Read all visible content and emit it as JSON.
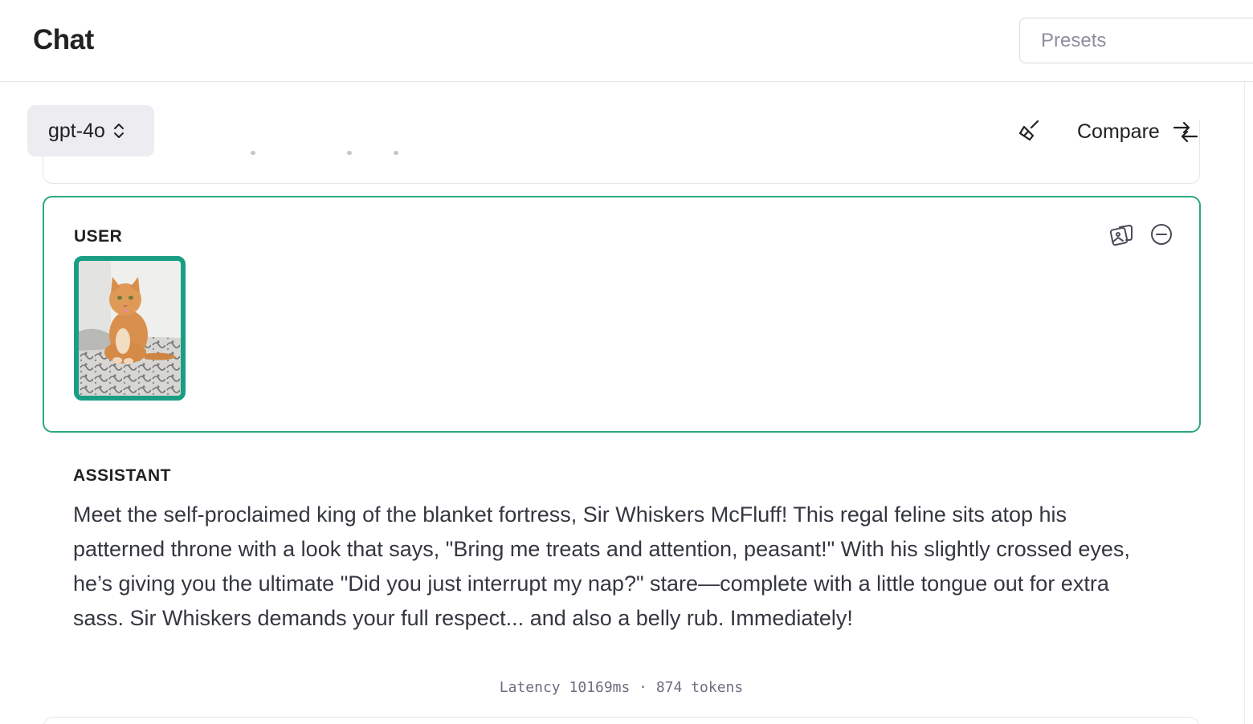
{
  "header": {
    "title": "Chat",
    "presets_placeholder": "Presets"
  },
  "toolbar": {
    "model": "gpt-4o",
    "compare_label": "Compare"
  },
  "messages": [
    {
      "role": "USER",
      "image_description_icon": "cat-photo",
      "active": true
    },
    {
      "role": "ASSISTANT",
      "text": "Meet the self-proclaimed king of the blanket fortress, Sir Whiskers McFluff! This regal feline sits atop his patterned throne with a look that says, \"Bring me treats and attention, peasant!\" With his slightly crossed eyes, he’s giving you the ultimate \"Did you just interrupt my nap?\" stare—complete with a little tongue out for extra sass. Sir Whiskers demands your full respect... and also a belly rub. Immediately!"
    }
  ],
  "stats": {
    "text": "Latency 10169ms · 874 tokens"
  },
  "colors": {
    "accent": "#10a37f",
    "selected_border": "#2aa883",
    "muted_bg": "#ececf1"
  },
  "icons": {
    "model_chevron": "chevron-up-down-icon",
    "clear": "broom-icon",
    "compare": "compare-arrows-icon",
    "image": "add-image-icon",
    "remove": "minus-circle-icon"
  }
}
